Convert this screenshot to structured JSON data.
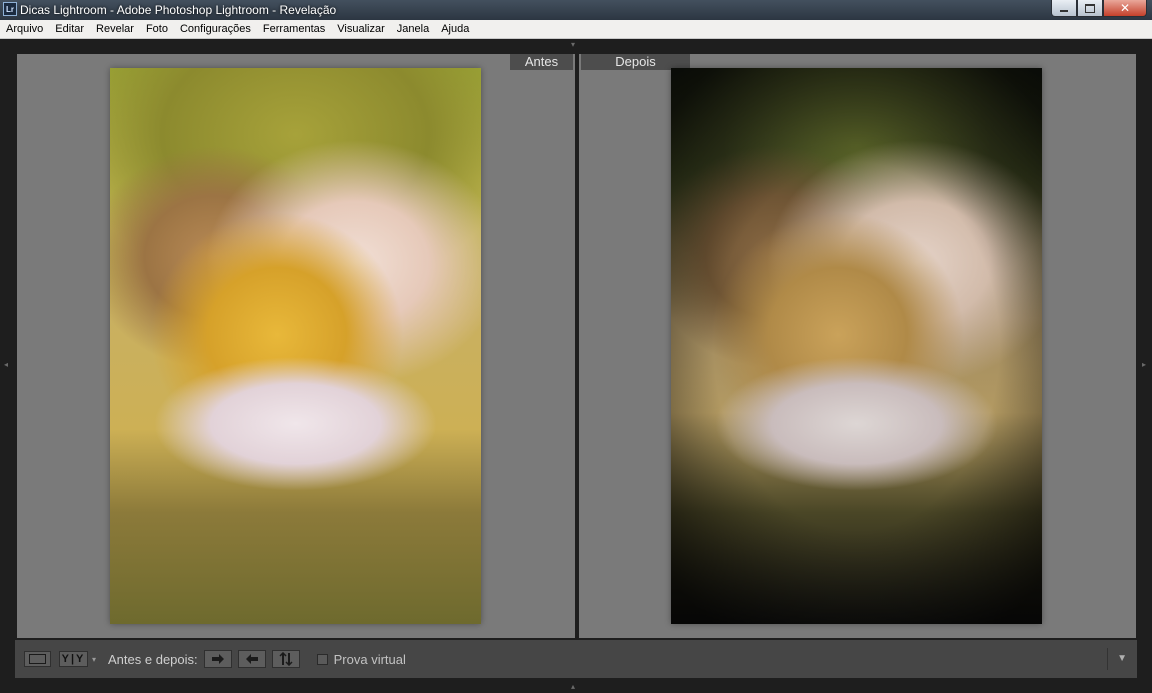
{
  "window": {
    "title": "Dicas Lightroom - Adobe Photoshop Lightroom - Revelação",
    "app_icon_text": "Lr",
    "icon": "lightroom-logo-icon"
  },
  "menu": {
    "items": [
      "Arquivo",
      "Editar",
      "Revelar",
      "Foto",
      "Configurações",
      "Ferramentas",
      "Visualizar",
      "Janela",
      "Ajuda"
    ]
  },
  "panes": {
    "before_label": "Antes",
    "after_label": "Depois"
  },
  "toolbar": {
    "loupe_icon": "loupe-view-icon",
    "compare_text": "Y|Y",
    "before_after_label": "Antes e depois:",
    "copy_right_icon": "copy-before-to-after-icon",
    "copy_left_icon": "copy-after-to-before-icon",
    "swap_icon": "swap-before-after-icon",
    "soft_proof_label": "Prova virtual",
    "soft_proof_checked": false,
    "menu_icon": "toolbar-menu-icon"
  }
}
